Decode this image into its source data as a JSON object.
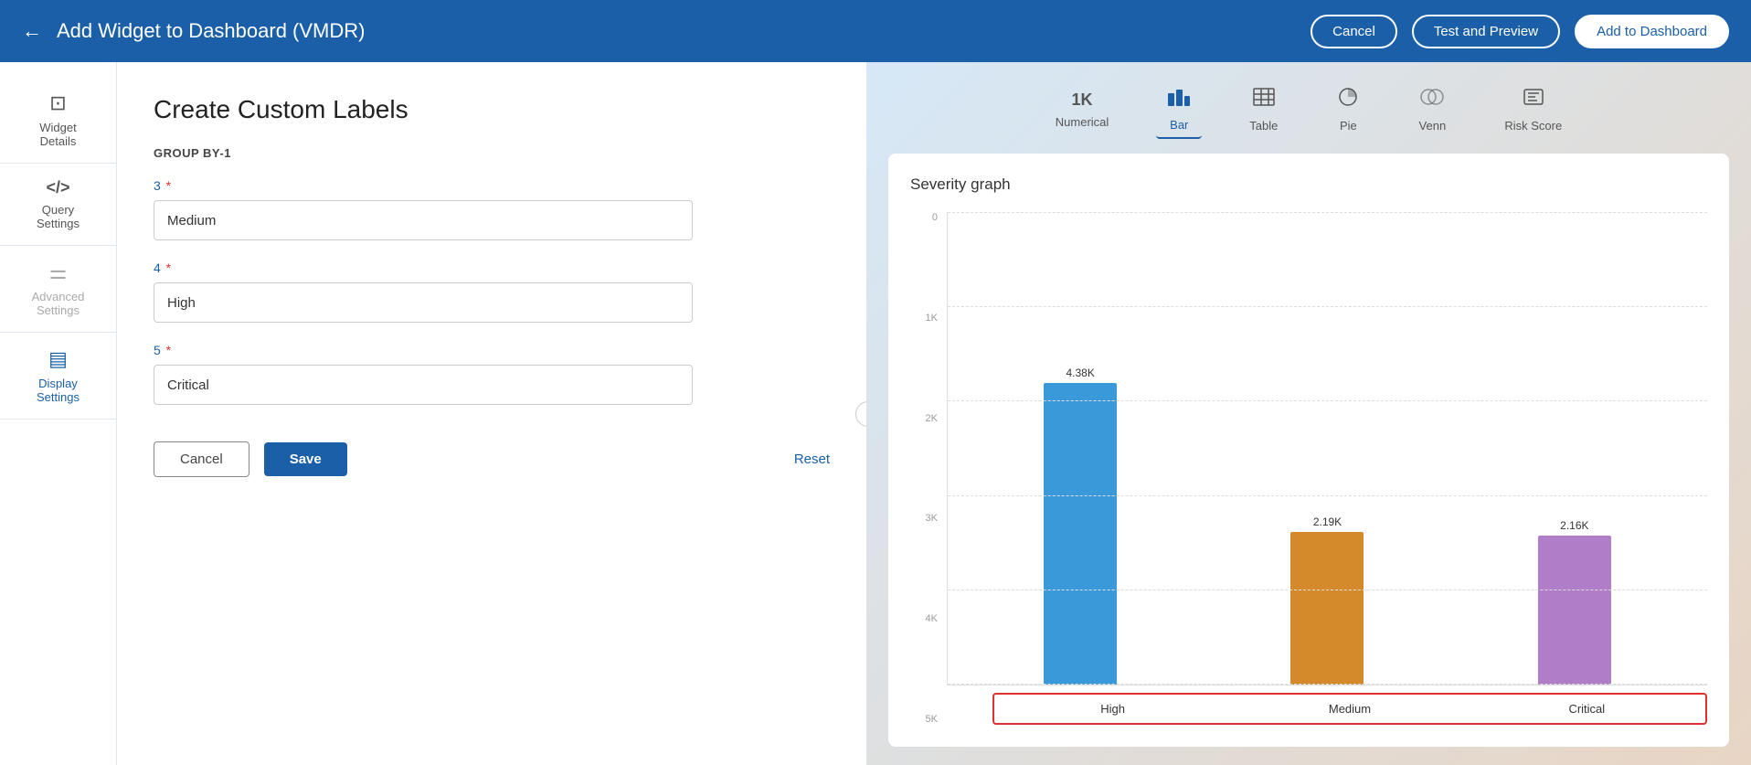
{
  "header": {
    "title": "Add Widget to Dashboard (VMDR)",
    "back_arrow": "←",
    "cancel_label": "Cancel",
    "test_preview_label": "Test and Preview",
    "add_dashboard_label": "Add to Dashboard"
  },
  "sidebar": {
    "items": [
      {
        "id": "widget-details",
        "icon": "⊡",
        "label": "Widget\nDetails",
        "state": "default"
      },
      {
        "id": "query-settings",
        "icon": "</>",
        "label": "Query\nSettings",
        "state": "default"
      },
      {
        "id": "advanced-settings",
        "icon": "≡",
        "label": "Advanced\nSettings",
        "state": "disabled"
      },
      {
        "id": "display-settings",
        "icon": "▤",
        "label": "Display\nSettings",
        "state": "active"
      }
    ]
  },
  "form": {
    "title": "Create Custom Labels",
    "group_label": "GROUP BY-1",
    "fields": [
      {
        "id": "field-3",
        "number": "3",
        "required": true,
        "value": "Medium"
      },
      {
        "id": "field-4",
        "number": "4",
        "required": true,
        "value": "High"
      },
      {
        "id": "field-5",
        "number": "5",
        "required": true,
        "value": "Critical"
      }
    ],
    "cancel_label": "Cancel",
    "save_label": "Save",
    "reset_label": "Reset"
  },
  "chart_types": [
    {
      "id": "numerical",
      "icon": "1K",
      "label": "Numerical",
      "active": false
    },
    {
      "id": "bar",
      "icon": "bar",
      "label": "Bar",
      "active": true
    },
    {
      "id": "table",
      "icon": "table",
      "label": "Table",
      "active": false
    },
    {
      "id": "pie",
      "icon": "pie",
      "label": "Pie",
      "active": false
    },
    {
      "id": "venn",
      "icon": "venn",
      "label": "Venn",
      "active": false
    },
    {
      "id": "riskscore",
      "icon": "risk",
      "label": "Risk Score",
      "active": false
    }
  ],
  "chart": {
    "title": "Severity graph",
    "y_axis_labels": [
      "0",
      "1K",
      "2K",
      "3K",
      "4K",
      "5K"
    ],
    "bars": [
      {
        "label": "High",
        "value": "4.38K",
        "height_pct": 87,
        "color": "blue"
      },
      {
        "label": "Medium",
        "value": "2.19K",
        "height_pct": 44,
        "color": "orange"
      },
      {
        "label": "Critical",
        "value": "2.16K",
        "height_pct": 43,
        "color": "purple"
      }
    ]
  },
  "collapse_icon": "‹"
}
